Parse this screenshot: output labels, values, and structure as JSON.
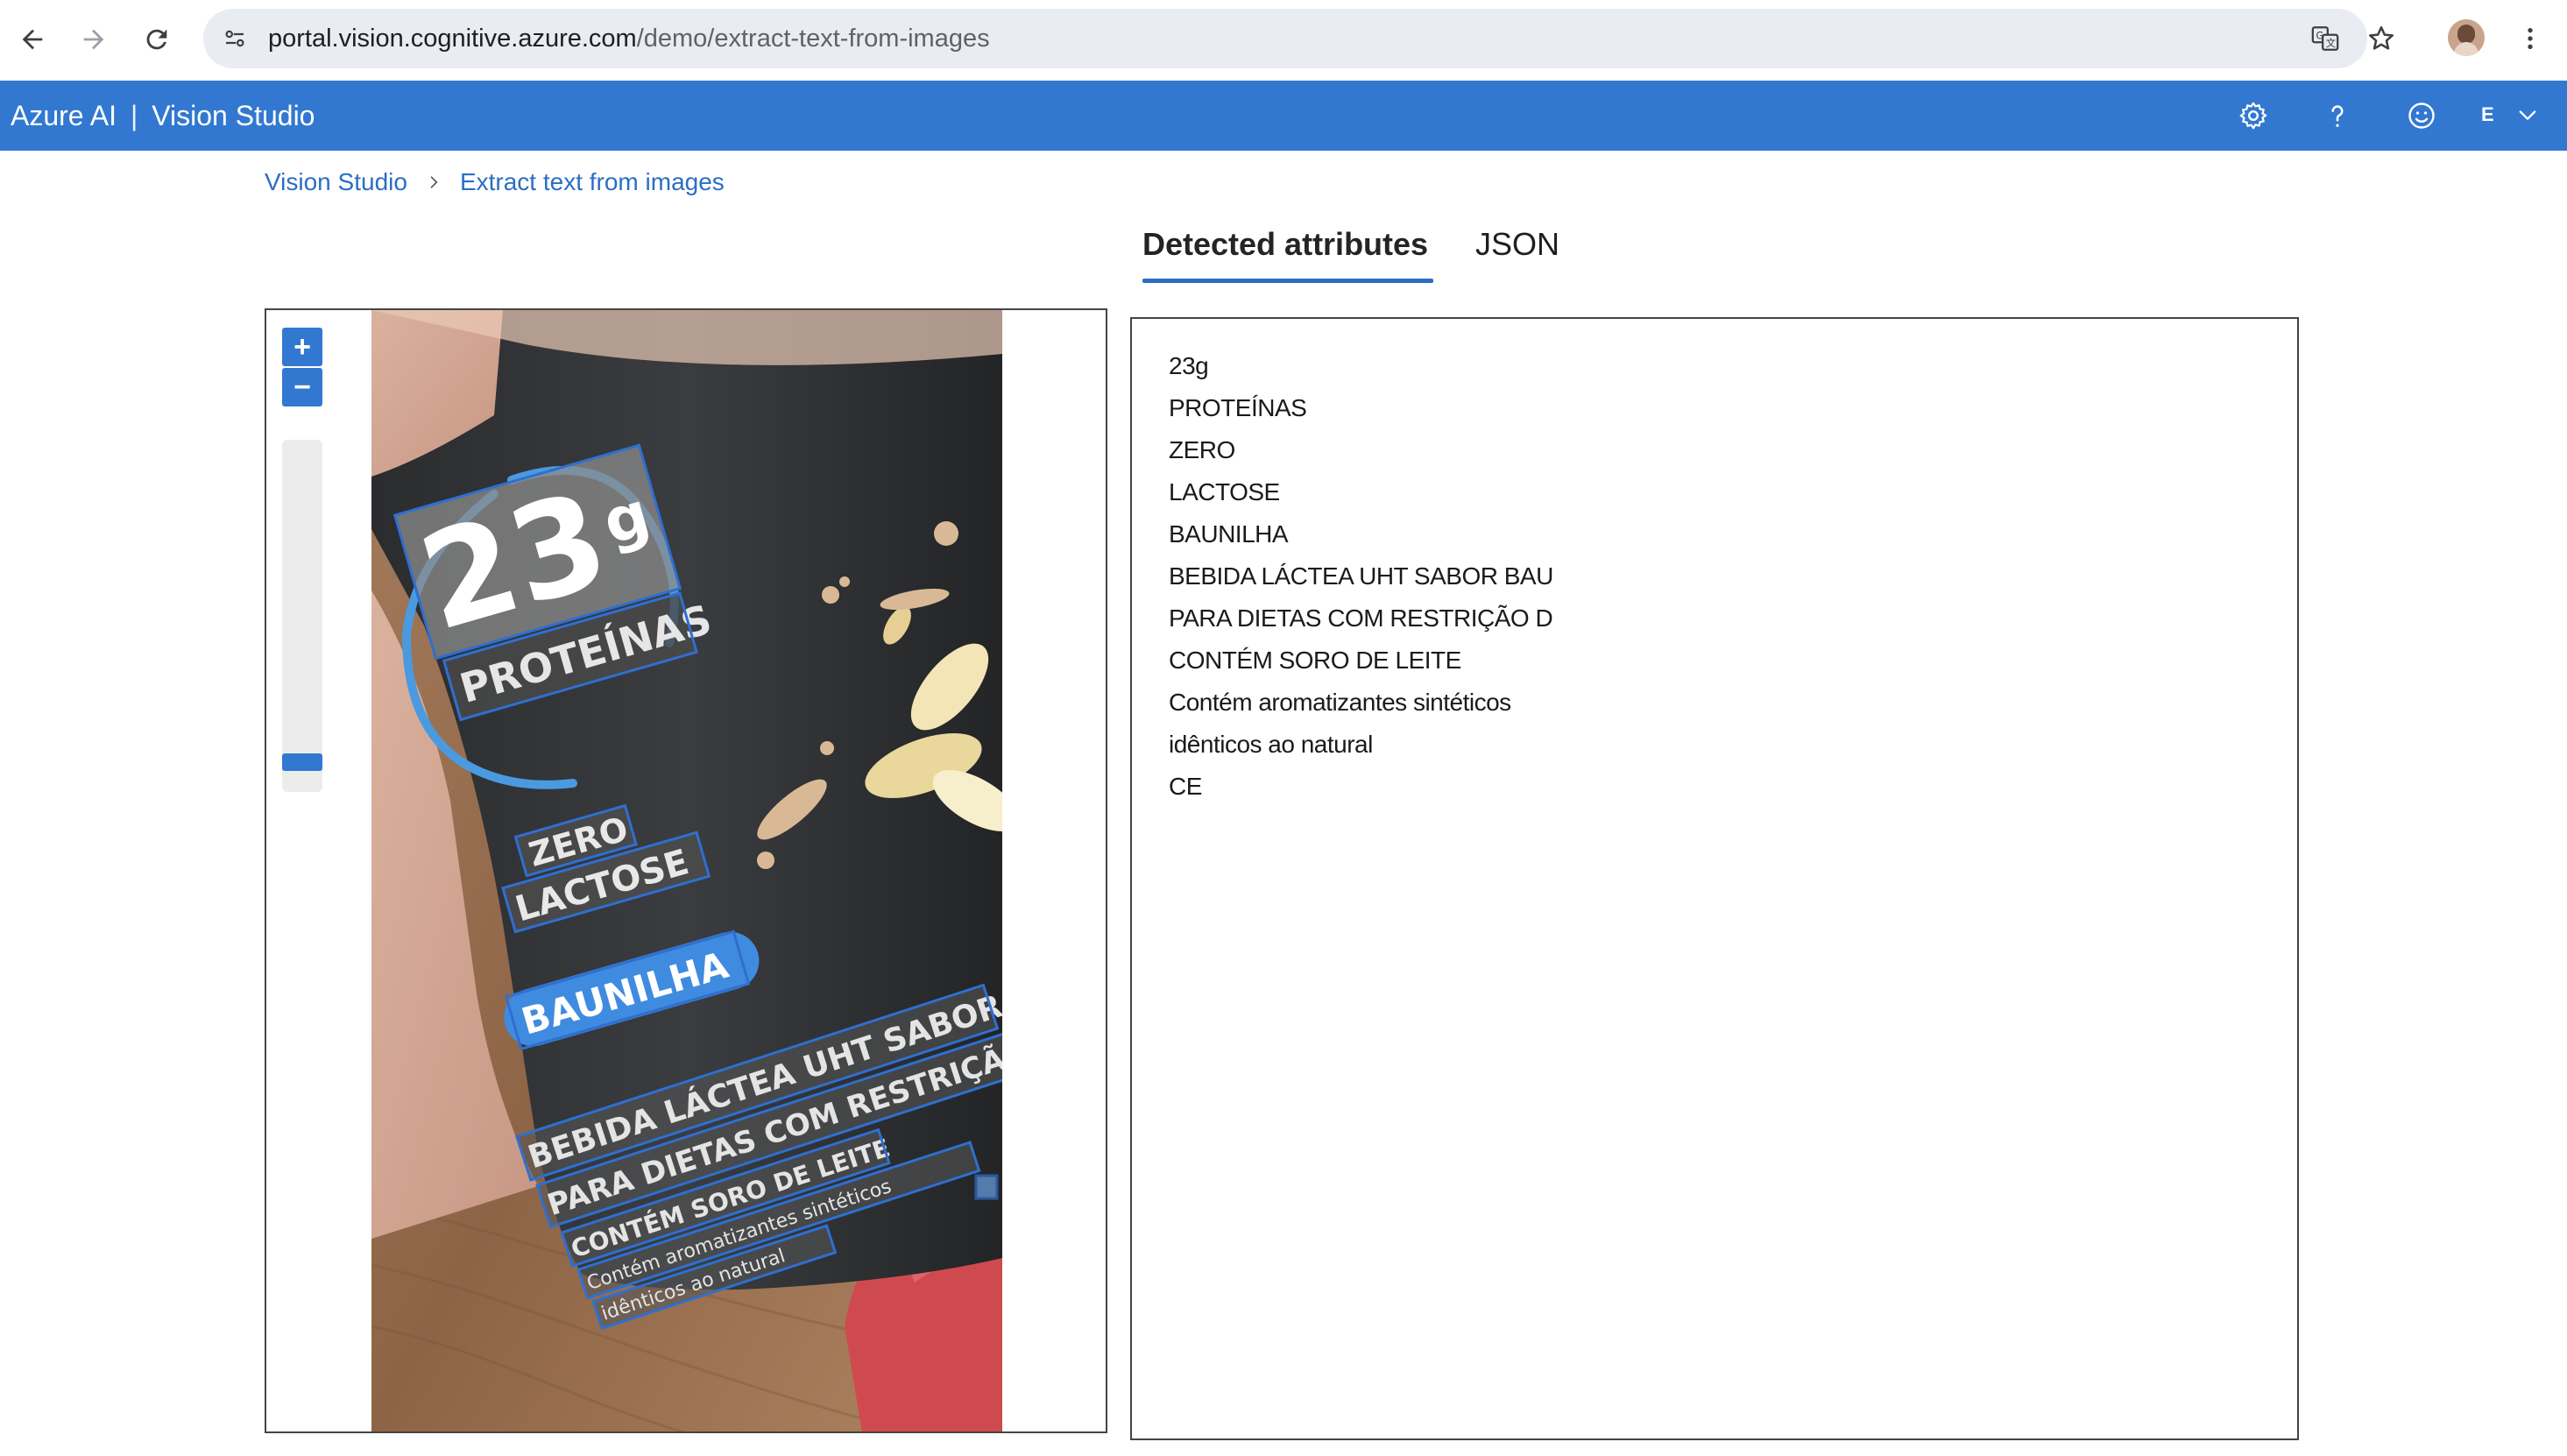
{
  "browser": {
    "url_host": "portal.vision.cognitive.azure.com",
    "url_path": "/demo/extract-text-from-images",
    "icons": [
      "back-arrow-icon",
      "forward-arrow-icon",
      "reload-icon",
      "site-settings-icon",
      "translate-icon",
      "bookmark-star-icon",
      "more-vert-icon"
    ]
  },
  "header": {
    "brand": "Azure AI",
    "separator": "|",
    "product": "Vision Studio",
    "user_initial": "E",
    "accent": "#3278d0"
  },
  "breadcrumb": {
    "items": [
      "Vision Studio",
      "Extract text from images"
    ]
  },
  "tabs": {
    "active": "Detected attributes",
    "other": "JSON"
  },
  "zoom": {
    "zoom_in": "+",
    "zoom_out": "−",
    "level": 0.2
  },
  "photo": {
    "text_23": "23",
    "text_g": "g",
    "text_proteinas": "PROTEÍNAS",
    "text_zero": "ZERO",
    "text_lactose": "LACTOSE",
    "text_baunilha": "BAUNILHA",
    "line1": "BEBIDA LÁCTEA UHT SABOR BAU",
    "line2": "PARA DIETAS COM RESTRIÇÃO D",
    "line3": "CONTÉM SORO DE LEITE",
    "line4": "Contém aromatizantes sintéticos",
    "line5": "idênticos ao natural"
  },
  "results": {
    "lines": [
      "23g",
      "PROTEÍNAS",
      "ZERO",
      "LACTOSE",
      "BAUNILHA",
      "BEBIDA LÁCTEA UHT SABOR BAU",
      "PARA DIETAS COM RESTRIÇÃO D",
      "CONTÉM SORO DE LEITE",
      "Contém aromatizantes sintéticos",
      "idênticos ao natural",
      "CE"
    ]
  }
}
